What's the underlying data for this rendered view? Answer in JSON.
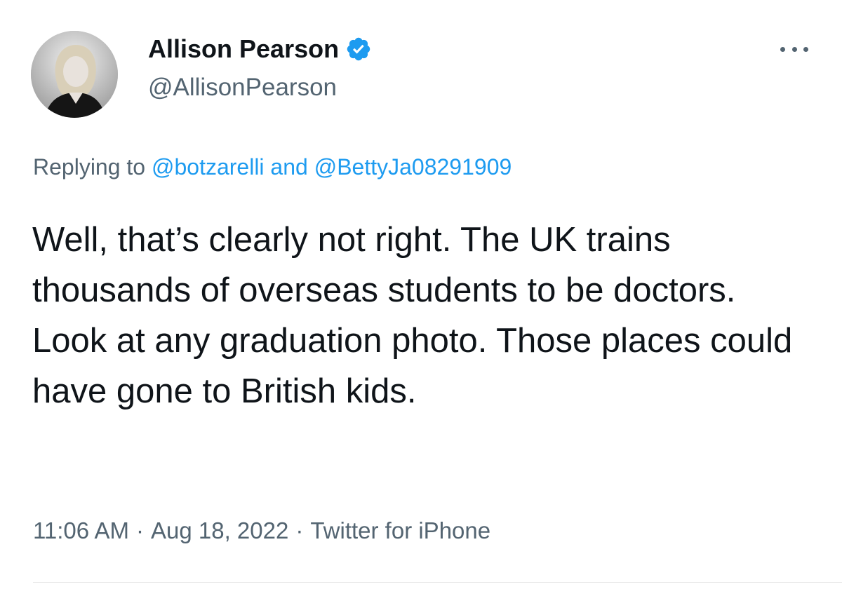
{
  "author": {
    "name": "Allison Pearson",
    "handle": "@AllisonPearson",
    "avatar_icon": "profile-photo",
    "verified_icon": "verified-badge-icon"
  },
  "menu": {
    "icon": "more-options-icon"
  },
  "reply": {
    "prefix": "Replying to",
    "mention_1": "@botzarelli",
    "connector": "and",
    "mention_2": "@BettyJa08291909"
  },
  "body": "Well, that’s clearly not right. The UK trains thousands of overseas students to be doctors. Look at any graduation photo. Those places could have gone to British kids.",
  "meta": {
    "time": "11:06 AM",
    "separator": "·",
    "date": "Aug 18, 2022",
    "source": "Twitter for iPhone"
  },
  "colors": {
    "text": "#0f1419",
    "secondary": "#536471",
    "link": "#1d9bf0",
    "verified": "#1d9bf0"
  }
}
